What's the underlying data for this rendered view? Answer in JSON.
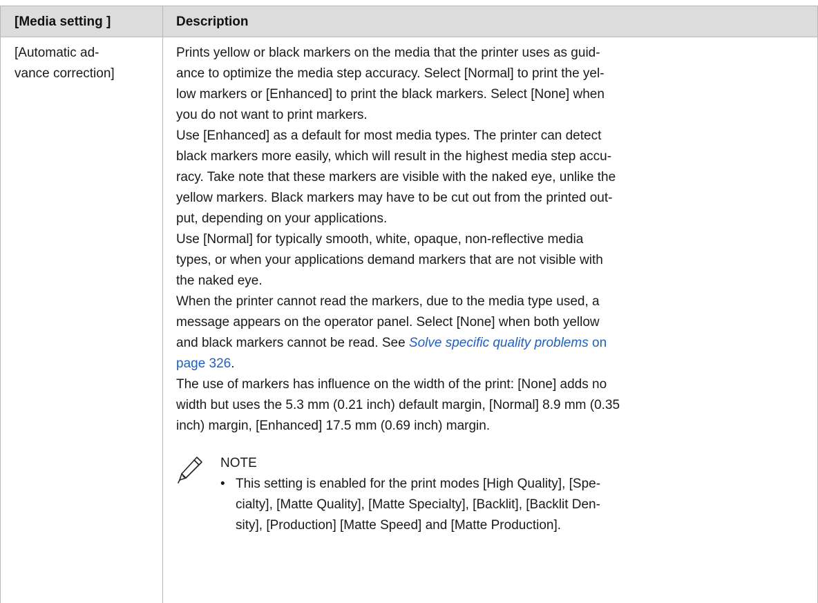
{
  "table": {
    "headers": {
      "setting": "[Media setting ]",
      "description": "Description"
    },
    "row": {
      "setting_lines": [
        "[Automatic ad-",
        "vance correction]"
      ],
      "description_lines": [
        "Prints yellow or black markers on the media that the printer uses as guid-",
        "ance to optimize the media step accuracy. Select [Normal] to print the yel-",
        "low markers or [Enhanced] to print the black markers. Select [None] when",
        "you do not want to print markers.",
        "Use [Enhanced] as a default for most media types. The printer can detect",
        "black markers more easily, which will result in the highest media step accu-",
        "racy. Take note that these markers are visible with the naked eye, unlike the",
        "yellow markers. Black markers may have to be cut out from the printed out-",
        "put, depending on your applications.",
        "Use [Normal] for typically smooth, white, opaque, non-reflective media",
        "types, or when your applications demand markers that are not visible with",
        "the naked eye.",
        "When the printer cannot read the markers, due to the media type used, a",
        "message appears on the operator panel. Select [None] when both yellow"
      ],
      "see_line": {
        "prefix": "and black markers cannot be read. See ",
        "link_title": "Solve specific quality problems",
        "link_on": " on",
        "link_page": "page 326",
        "suffix": "."
      },
      "after_lines": [
        "The use of markers has influence on the width of the print: [None] adds no",
        "width but uses the 5.3 mm (0.21 inch) default margin, [Normal] 8.9 mm (0.35",
        "inch) margin, [Enhanced] 17.5 mm (0.69 inch) margin."
      ],
      "note": {
        "icon": "pencil-note-icon",
        "title": "NOTE",
        "bullet": "•",
        "lines": [
          "This setting is enabled for the print modes [High Quality], [Spe-",
          "cialty], [Matte Quality], [Matte Specialty], [Backlit], [Backlit Den-",
          "sity], [Production] [Matte Speed] and [Matte Production]."
        ]
      }
    }
  }
}
